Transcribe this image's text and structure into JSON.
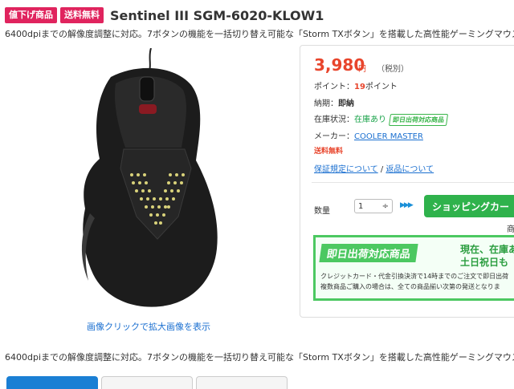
{
  "header": {
    "badges": [
      "値下げ商品",
      "送料無料"
    ],
    "title": "Sentinel III SGM-6020-KLOW1",
    "subtitle": "6400dpiまでの解像度調整に対応。7ボタンの機能を一括切り替え可能な「Storm TXボタン」を搭載した高性能ゲーミングマウス"
  },
  "image": {
    "caption": "画像クリックで拡大画像を表示",
    "icon": "gaming-mouse-photo"
  },
  "price": {
    "amount": "3,980",
    "unit": "円",
    "tax": "（税別）"
  },
  "info": {
    "points_label": "ポイント：",
    "points_value": "19",
    "points_unit": "ポイント",
    "delivery_label": "納期：",
    "delivery_value": "即納",
    "stock_label": "在庫状況：",
    "stock_value": "在庫あり",
    "stock_badge": "即日出荷対応商品",
    "maker_label": "メーカー：",
    "maker_value": "COOLER MASTER",
    "shipping": "送料無料",
    "warranty_link": "保証規定について",
    "separator": " / ",
    "return_link": "返品について"
  },
  "order": {
    "qty_label": "数量",
    "qty_value": "1",
    "qty_arrow": "÷",
    "arrows": "▶▶▶",
    "cart_button": "ショッピングカー",
    "fragment": "商品"
  },
  "promo": {
    "headline": "即日出荷対応商品",
    "right_line1": "現在、在庫あ",
    "right_line2": "土日祝日も",
    "line1": "クレジットカード・代金引換決済で14時までのご注文で即日出荷",
    "line2": "複数商品ご購入の場合は、全ての商品揃い次第の発送となりま"
  },
  "description": "6400dpiまでの解像度調整に対応。7ボタンの機能を一括切り替え可能な「Storm TXボタン」を搭載した高性能ゲーミングマウス",
  "colors": {
    "badge": "#e0245e",
    "price": "#e8452c",
    "accent_green": "#2fb24c",
    "link": "#1a6fd0"
  }
}
